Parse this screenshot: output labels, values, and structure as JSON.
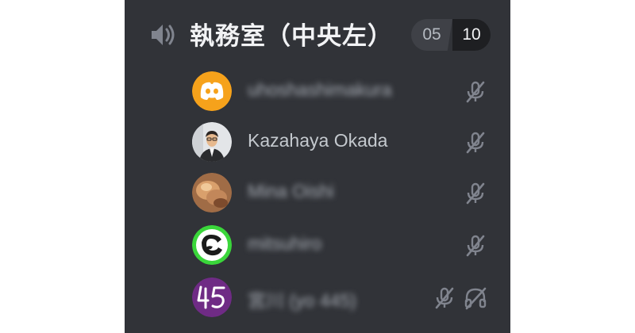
{
  "channel": {
    "icon": "speaker-icon",
    "name": "執務室（中央左）",
    "user_count": "05",
    "user_limit": "10"
  },
  "members": [
    {
      "name": "uhoshashimakura",
      "avatar": "discord-logo-avatar",
      "avatar_color": "#f6a21b",
      "muted": true,
      "deafened": false,
      "name_obscured": true
    },
    {
      "name": "Kazahaya Okada",
      "avatar": "photo-avatar",
      "muted": true,
      "deafened": false,
      "name_obscured": false
    },
    {
      "name": "Mina Oishi",
      "avatar": "photo-avatar",
      "muted": true,
      "deafened": false,
      "name_obscured": true
    },
    {
      "name": "mitsuhiro",
      "avatar": "green-logo-avatar",
      "avatar_color": "#3ad63a",
      "muted": true,
      "deafened": false,
      "name_obscured": true
    },
    {
      "name": "宮川 (yo 445)",
      "avatar": "45-avatar",
      "avatar_color": "#6f2b85",
      "muted": true,
      "deafened": true,
      "name_obscured": true
    }
  ],
  "colors": {
    "panel_background": "#313338",
    "text_primary": "#f2f3f5",
    "text_muted": "#b5bac1",
    "icon_color": "#80848e"
  }
}
